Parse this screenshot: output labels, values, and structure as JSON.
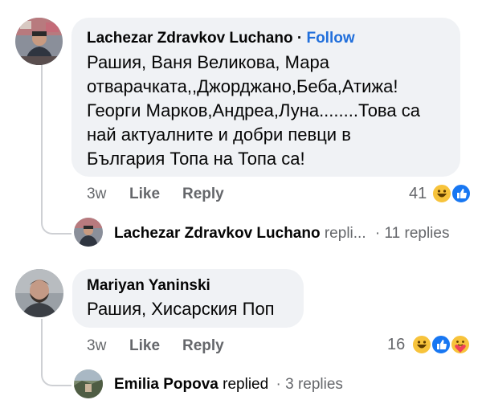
{
  "comments": [
    {
      "author": "Lachezar Zdravkov Luchano",
      "follow_label": "Follow",
      "separator": "·",
      "text_lines": [
        "Рашия, Ваня Великова, Мара",
        "отварачката,,Джорджано,Беба,Атижа!",
        "Георги Марков,Андреа,Луна........Това са",
        "най актуалните и добри певци в",
        "България Топа на Топа са!"
      ],
      "time": "3w",
      "like_label": "Like",
      "reply_label": "Reply",
      "reaction_count": "41",
      "reactions": [
        "haha-icon",
        "like-icon"
      ],
      "reply_preview": {
        "author": "Lachezar Zdravkov Luchano",
        "action": "repli...",
        "separator": "·",
        "count": "11 replies"
      }
    },
    {
      "author": "Mariyan Yaninski",
      "text_lines": [
        "Рашия, Хисарския Поп"
      ],
      "time": "3w",
      "like_label": "Like",
      "reply_label": "Reply",
      "reaction_count": "16",
      "reactions": [
        "haha-icon",
        "like-icon",
        "care-icon"
      ],
      "reply_preview": {
        "author": "Emilia Popova",
        "action": "replied",
        "separator": "·",
        "count": "3 replies"
      }
    }
  ],
  "colors": {
    "bubble": "#f0f2f5",
    "follow": "#216fdb",
    "muted": "#65676b",
    "like_blue": "#1877f2",
    "haha_yellow": "#f7c33b"
  }
}
